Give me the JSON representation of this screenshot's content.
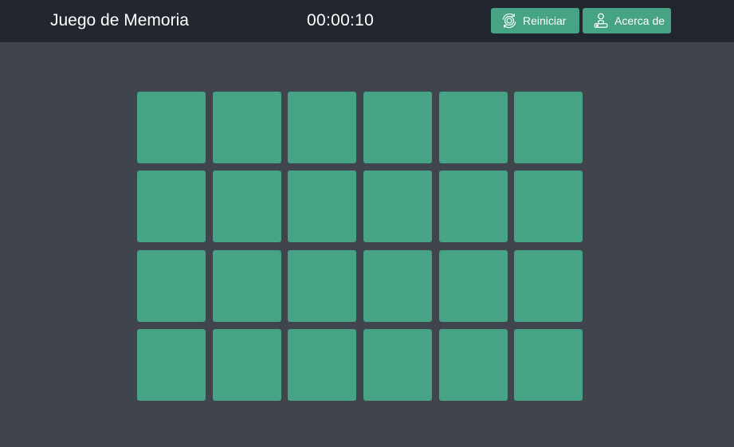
{
  "header": {
    "title": "Juego de Memoria",
    "timer": "00:00:10",
    "restart_label": "Reiniciar",
    "restart_icon": "refresh-icon",
    "about_label": "Acerca de",
    "about_icon": "person-icon"
  },
  "colors": {
    "header_bg": "#22262f",
    "page_bg": "#40444d",
    "accent": "#46a386",
    "text": "#ffffff"
  },
  "board": {
    "rows": 4,
    "columns": 6,
    "cards_face_down": 24
  }
}
